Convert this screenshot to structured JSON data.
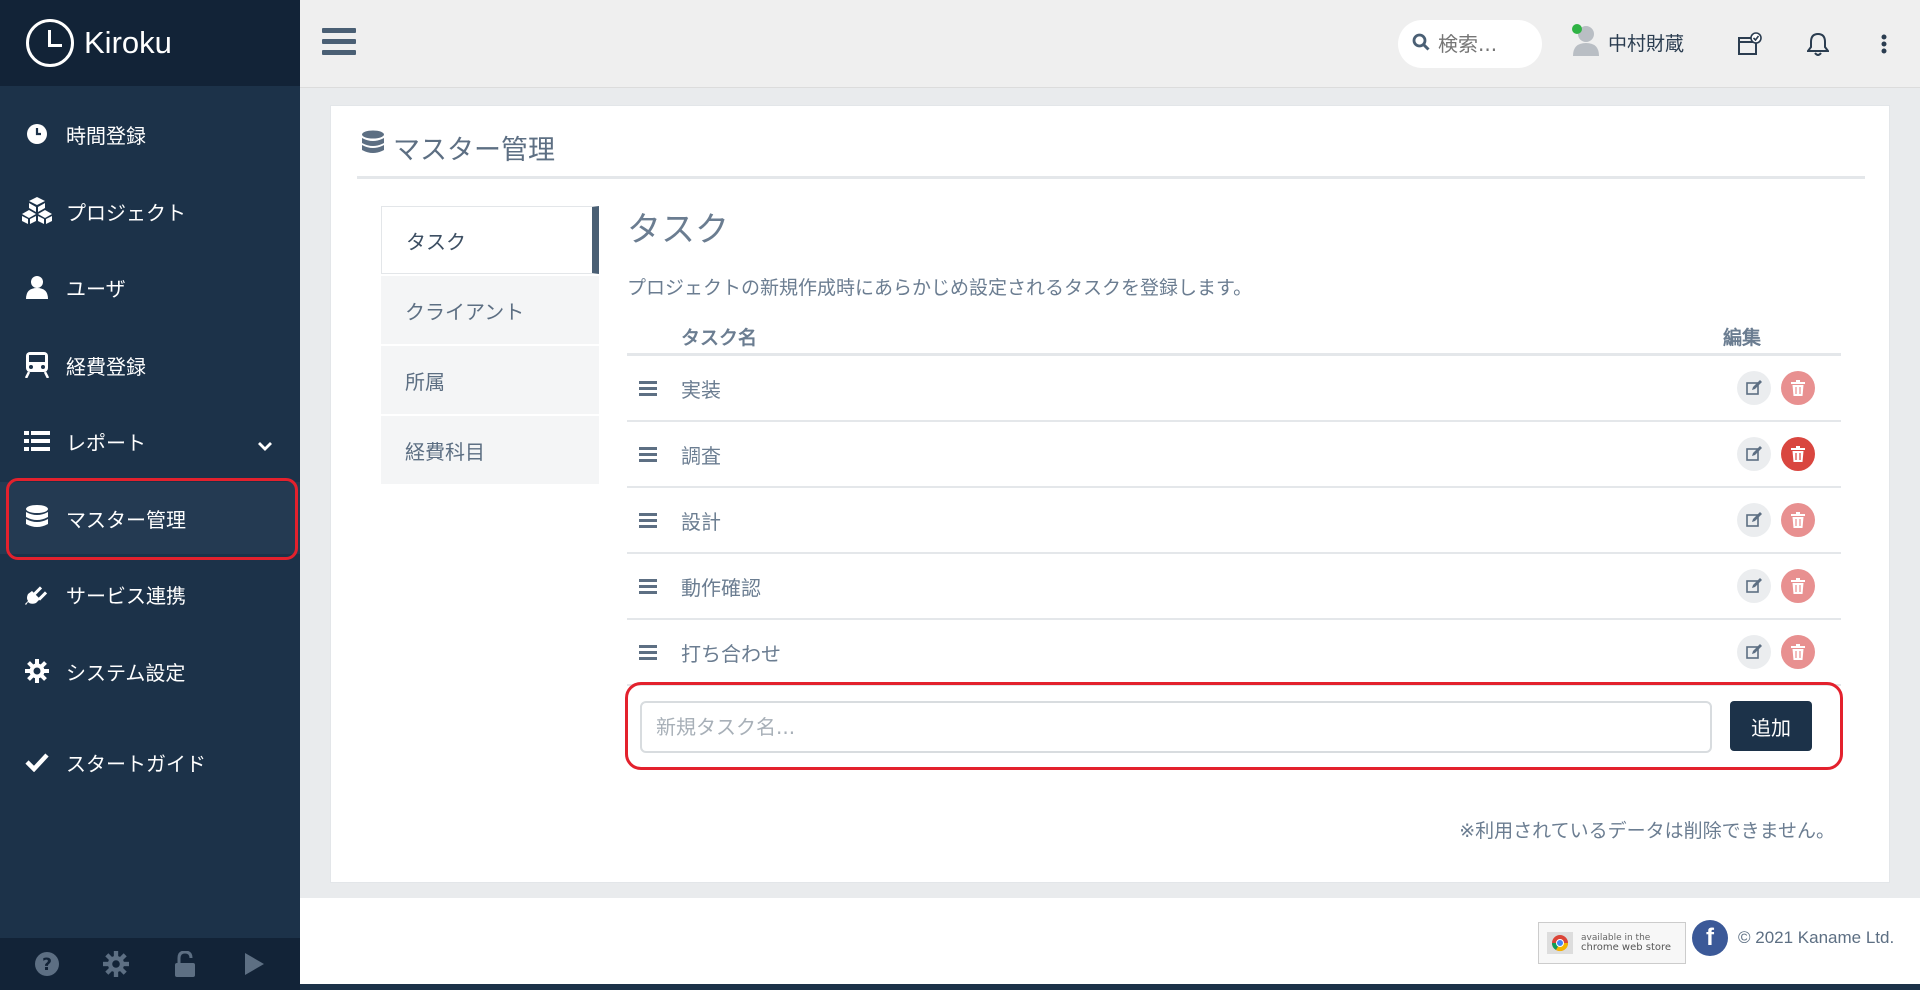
{
  "app": {
    "name": "Kiroku"
  },
  "sidebar": {
    "items": [
      {
        "label": "時間登録",
        "icon": "clock-icon"
      },
      {
        "label": "プロジェクト",
        "icon": "cubes-icon"
      },
      {
        "label": "ユーザ",
        "icon": "user-icon"
      },
      {
        "label": "経費登録",
        "icon": "train-icon"
      },
      {
        "label": "レポート",
        "icon": "list-icon",
        "has_submenu": true
      },
      {
        "label": "マスター管理",
        "icon": "database-icon",
        "active": true
      },
      {
        "label": "サービス連携",
        "icon": "plug-icon"
      },
      {
        "label": "システム設定",
        "icon": "gear-icon"
      },
      {
        "label": "スタートガイド",
        "icon": "check-icon"
      }
    ],
    "footer_icons": [
      "help-icon",
      "settings-icon",
      "unlock-icon",
      "play-icon"
    ]
  },
  "topbar": {
    "search_placeholder": "検索...",
    "user_name": "中村財蔵",
    "status_color": "#2fb344"
  },
  "page": {
    "title": "マスター管理",
    "subnav": [
      {
        "label": "タスク",
        "active": true
      },
      {
        "label": "クライアント"
      },
      {
        "label": "所属"
      },
      {
        "label": "経費科目"
      }
    ],
    "section_title": "タスク",
    "description": "プロジェクトの新規作成時にあらかじめ設定されるタスクを登録します。",
    "table": {
      "col_name": "タスク名",
      "col_edit": "編集",
      "rows": [
        {
          "name": "実装",
          "deletable": false
        },
        {
          "name": "調査",
          "deletable": true
        },
        {
          "name": "設計",
          "deletable": false
        },
        {
          "name": "動作確認",
          "deletable": false
        },
        {
          "name": "打ち合わせ",
          "deletable": false
        }
      ]
    },
    "add": {
      "placeholder": "新規タスク名...",
      "button": "追加"
    },
    "note": "※利用されているデータは削除できません。"
  },
  "footer": {
    "cws_small": "available in the",
    "cws_big": "chrome web store",
    "fb": "f",
    "copyright": "© 2021 Kaname Ltd."
  },
  "colors": {
    "sidebar": "#1c3249",
    "accent_red": "#e3212d",
    "delete": "#d9463f",
    "primary_button": "#1c3249"
  }
}
